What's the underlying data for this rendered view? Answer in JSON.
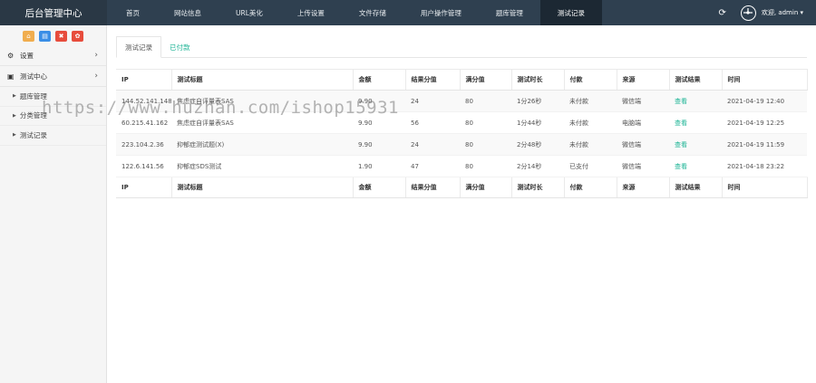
{
  "brand": "后台管理中心",
  "nav": [
    {
      "label": "首页",
      "active": false
    },
    {
      "label": "网站信息",
      "active": false
    },
    {
      "label": "URL美化",
      "active": false
    },
    {
      "label": "上传设置",
      "active": false
    },
    {
      "label": "文件存储",
      "active": false
    },
    {
      "label": "用户操作管理",
      "active": false
    },
    {
      "label": "题库管理",
      "active": false
    },
    {
      "label": "测试记录",
      "active": true
    }
  ],
  "top_right": {
    "refresh_icon": "refresh-icon",
    "welcome": "欢迎, admin ▾"
  },
  "quick_buttons": [
    {
      "icon": "home-icon",
      "glyph": "⌂",
      "color": "#f0ad4e"
    },
    {
      "icon": "file-icon",
      "glyph": "▤",
      "color": "#3a8ee6"
    },
    {
      "icon": "trash-icon",
      "glyph": "✖",
      "color": "#e74c3c"
    },
    {
      "icon": "gear-icon",
      "glyph": "✿",
      "color": "#e74c3c"
    }
  ],
  "sidebar": {
    "settings": "设置",
    "test_center": "测试中心",
    "sub_items": [
      "题库管理",
      "分类管理",
      "测试记录"
    ]
  },
  "tabs": [
    "测试记录",
    "已付款"
  ],
  "table": {
    "headers": [
      "IP",
      "测试标题",
      "金额",
      "结果分值",
      "满分值",
      "测试时长",
      "付款",
      "来源",
      "测试结果",
      "时间"
    ],
    "rows": [
      [
        "144.52.141.148",
        "焦虑症自评量表SAS",
        "9.90",
        "24",
        "80",
        "1分26秒",
        "未付款",
        "微信端",
        "查看",
        "2021-04-19 12:40"
      ],
      [
        "60.215.41.162",
        "焦虑症自评量表SAS",
        "9.90",
        "56",
        "80",
        "1分44秒",
        "未付款",
        "电脑端",
        "查看",
        "2021-04-19 12:25"
      ],
      [
        "223.104.2.36",
        "抑郁症测试题(X)",
        "9.90",
        "24",
        "80",
        "2分48秒",
        "未付款",
        "微信端",
        "查看",
        "2021-04-19 11:59"
      ],
      [
        "122.6.141.56",
        "抑郁症SDS测试",
        "1.90",
        "47",
        "80",
        "2分14秒",
        "已支付",
        "微信端",
        "查看",
        "2021-04-18 23:22"
      ]
    ]
  },
  "watermark": "https://www.huzhan.com/ishop15931"
}
